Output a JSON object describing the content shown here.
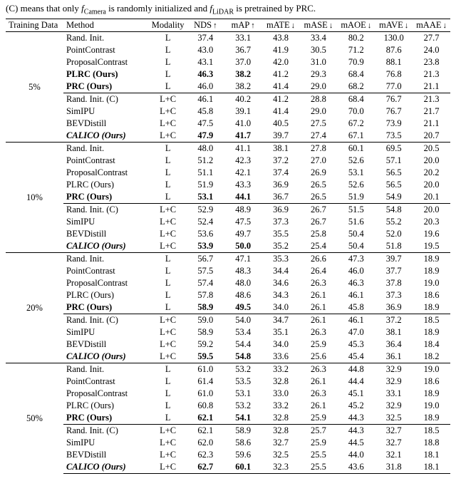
{
  "caption_parts": {
    "pre": "(C) means that only ",
    "fcam_base": "f",
    "fcam_sub": "Camera",
    "mid1": " is randomly initialized and ",
    "flid_base": "f",
    "flid_sub": "LiDAR",
    "post": " is pretrained by PRC."
  },
  "headers": {
    "td": "Training Data",
    "method": "Method",
    "modality": "Modality",
    "cols": [
      {
        "label": "NDS",
        "arrow": "↑"
      },
      {
        "label": "mAP",
        "arrow": "↑"
      },
      {
        "label": "mATE",
        "arrow": "↓"
      },
      {
        "label": "mASE",
        "arrow": "↓"
      },
      {
        "label": "mAOE",
        "arrow": "↓"
      },
      {
        "label": "mAVE",
        "arrow": "↓"
      },
      {
        "label": "mAAE",
        "arrow": "↓"
      }
    ]
  },
  "groups": [
    {
      "td_label": "5%",
      "blocks": [
        {
          "rows": [
            {
              "method": "Rand. Init.",
              "mod": "L",
              "v": [
                "37.4",
                "33.1",
                "43.8",
                "33.4",
                "80.2",
                "130.0",
                "27.7"
              ]
            },
            {
              "method": "PointContrast",
              "mod": "L",
              "v": [
                "43.0",
                "36.7",
                "41.9",
                "30.5",
                "71.2",
                "87.6",
                "24.0"
              ]
            },
            {
              "method": "ProposalContrast",
              "mod": "L",
              "v": [
                "43.1",
                "37.0",
                "42.0",
                "31.0",
                "70.9",
                "88.1",
                "23.8"
              ]
            },
            {
              "method": "PLRC (Ours)",
              "mod": "L",
              "v": [
                "46.3",
                "38.2",
                "41.2",
                "29.3",
                "68.4",
                "76.8",
                "21.3"
              ],
              "boldMethod": true,
              "boldIdx": [
                0,
                1
              ]
            },
            {
              "method": "PRC (Ours)",
              "mod": "L",
              "v": [
                "46.0",
                "38.2",
                "41.4",
                "29.0",
                "68.2",
                "77.0",
                "21.1"
              ],
              "boldMethod": true
            }
          ]
        },
        {
          "rows": [
            {
              "method": "Rand. Init. (C)",
              "mod": "L+C",
              "v": [
                "46.1",
                "40.2",
                "41.2",
                "28.8",
                "68.4",
                "76.7",
                "21.3"
              ]
            },
            {
              "method": "SimIPU",
              "mod": "L+C",
              "v": [
                "45.8",
                "39.1",
                "41.4",
                "29.0",
                "70.0",
                "76.7",
                "21.7"
              ]
            },
            {
              "method": "BEVDistill",
              "mod": "L+C",
              "v": [
                "47.5",
                "41.0",
                "40.5",
                "27.5",
                "67.2",
                "73.9",
                "21.1"
              ]
            },
            {
              "method": "CALICO (Ours)",
              "mod": "L+C",
              "v": [
                "47.9",
                "41.7",
                "39.7",
                "27.4",
                "67.1",
                "73.5",
                "20.7"
              ],
              "italicMethod": true,
              "boldMethod": true,
              "boldIdx": [
                0,
                1
              ]
            }
          ]
        }
      ]
    },
    {
      "td_label": "10%",
      "blocks": [
        {
          "rows": [
            {
              "method": "Rand. Init.",
              "mod": "L",
              "v": [
                "48.0",
                "41.1",
                "38.1",
                "27.8",
                "60.1",
                "69.5",
                "20.5"
              ]
            },
            {
              "method": "PointContrast",
              "mod": "L",
              "v": [
                "51.2",
                "42.3",
                "37.2",
                "27.0",
                "52.6",
                "57.1",
                "20.0"
              ]
            },
            {
              "method": "ProposalContrast",
              "mod": "L",
              "v": [
                "51.1",
                "42.1",
                "37.4",
                "26.9",
                "53.1",
                "56.5",
                "20.2"
              ]
            },
            {
              "method": "PLRC (Ours)",
              "mod": "L",
              "v": [
                "51.9",
                "43.3",
                "36.9",
                "26.5",
                "52.6",
                "56.5",
                "20.0"
              ]
            },
            {
              "method": "PRC (Ours)",
              "mod": "L",
              "v": [
                "53.1",
                "44.1",
                "36.7",
                "26.5",
                "51.9",
                "54.9",
                "20.1"
              ],
              "boldMethod": true,
              "boldIdx": [
                0,
                1
              ]
            }
          ]
        },
        {
          "rows": [
            {
              "method": "Rand. Init. (C)",
              "mod": "L+C",
              "v": [
                "52.9",
                "48.9",
                "36.9",
                "26.7",
                "51.5",
                "54.8",
                "20.0"
              ]
            },
            {
              "method": "SimIPU",
              "mod": "L+C",
              "v": [
                "52.4",
                "47.5",
                "37.3",
                "26.7",
                "51.6",
                "55.2",
                "20.3"
              ]
            },
            {
              "method": "BEVDistill",
              "mod": "L+C",
              "v": [
                "53.6",
                "49.7",
                "35.5",
                "25.8",
                "50.4",
                "52.0",
                "19.6"
              ]
            },
            {
              "method": "CALICO (Ours)",
              "mod": "L+C",
              "v": [
                "53.9",
                "50.0",
                "35.2",
                "25.4",
                "50.4",
                "51.8",
                "19.5"
              ],
              "italicMethod": true,
              "boldMethod": true,
              "boldIdx": [
                0,
                1
              ]
            }
          ]
        }
      ]
    },
    {
      "td_label": "20%",
      "blocks": [
        {
          "rows": [
            {
              "method": "Rand. Init.",
              "mod": "L",
              "v": [
                "56.7",
                "47.1",
                "35.3",
                "26.6",
                "47.3",
                "39.7",
                "18.9"
              ]
            },
            {
              "method": "PointContrast",
              "mod": "L",
              "v": [
                "57.5",
                "48.3",
                "34.4",
                "26.4",
                "46.0",
                "37.7",
                "18.9"
              ]
            },
            {
              "method": "ProposalContrast",
              "mod": "L",
              "v": [
                "57.4",
                "48.0",
                "34.6",
                "26.3",
                "46.3",
                "37.8",
                "19.0"
              ]
            },
            {
              "method": "PLRC (Ours)",
              "mod": "L",
              "v": [
                "57.8",
                "48.6",
                "34.3",
                "26.1",
                "46.1",
                "37.3",
                "18.6"
              ]
            },
            {
              "method": "PRC (Ours)",
              "mod": "L",
              "v": [
                "58.9",
                "49.5",
                "34.0",
                "26.1",
                "45.8",
                "36.9",
                "18.9"
              ],
              "boldMethod": true,
              "boldIdx": [
                0,
                1
              ]
            }
          ]
        },
        {
          "rows": [
            {
              "method": "Rand. Init. (C)",
              "mod": "L+C",
              "v": [
                "59.0",
                "54.0",
                "34.7",
                "26.1",
                "46.1",
                "37.2",
                "18.5"
              ]
            },
            {
              "method": "SimIPU",
              "mod": "L+C",
              "v": [
                "58.9",
                "53.4",
                "35.1",
                "26.3",
                "47.0",
                "38.1",
                "18.9"
              ]
            },
            {
              "method": "BEVDistill",
              "mod": "L+C",
              "v": [
                "59.2",
                "54.4",
                "34.0",
                "25.9",
                "45.3",
                "36.4",
                "18.4"
              ]
            },
            {
              "method": "CALICO (Ours)",
              "mod": "L+C",
              "v": [
                "59.5",
                "54.8",
                "33.6",
                "25.6",
                "45.4",
                "36.1",
                "18.2"
              ],
              "italicMethod": true,
              "boldMethod": true,
              "boldIdx": [
                0,
                1
              ]
            }
          ]
        }
      ]
    },
    {
      "td_label": "50%",
      "blocks": [
        {
          "rows": [
            {
              "method": "Rand. Init.",
              "mod": "L",
              "v": [
                "61.0",
                "53.2",
                "33.2",
                "26.3",
                "44.8",
                "32.9",
                "19.0"
              ]
            },
            {
              "method": "PointContrast",
              "mod": "L",
              "v": [
                "61.4",
                "53.5",
                "32.8",
                "26.1",
                "44.4",
                "32.9",
                "18.6"
              ]
            },
            {
              "method": "ProposalContrast",
              "mod": "L",
              "v": [
                "61.0",
                "53.1",
                "33.0",
                "26.3",
                "45.1",
                "33.1",
                "18.9"
              ]
            },
            {
              "method": "PLRC (Ours)",
              "mod": "L",
              "v": [
                "60.8",
                "53.2",
                "33.2",
                "26.1",
                "45.2",
                "32.9",
                "19.0"
              ]
            },
            {
              "method": "PRC (Ours)",
              "mod": "L",
              "v": [
                "62.1",
                "54.1",
                "32.8",
                "25.9",
                "44.3",
                "32.5",
                "18.9"
              ],
              "boldMethod": true,
              "boldIdx": [
                0,
                1
              ]
            }
          ]
        },
        {
          "rows": [
            {
              "method": "Rand. Init. (C)",
              "mod": "L+C",
              "v": [
                "62.1",
                "58.9",
                "32.8",
                "25.7",
                "44.3",
                "32.7",
                "18.5"
              ]
            },
            {
              "method": "SimIPU",
              "mod": "L+C",
              "v": [
                "62.0",
                "58.6",
                "32.7",
                "25.9",
                "44.5",
                "32.7",
                "18.8"
              ]
            },
            {
              "method": "BEVDistill",
              "mod": "L+C",
              "v": [
                "62.3",
                "59.6",
                "32.5",
                "25.5",
                "44.0",
                "32.1",
                "18.1"
              ]
            },
            {
              "method": "CALICO (Ours)",
              "mod": "L+C",
              "v": [
                "62.7",
                "60.1",
                "32.3",
                "25.5",
                "43.6",
                "31.8",
                "18.1"
              ],
              "italicMethod": true,
              "boldMethod": true,
              "boldIdx": [
                0,
                1
              ]
            }
          ]
        }
      ]
    }
  ]
}
